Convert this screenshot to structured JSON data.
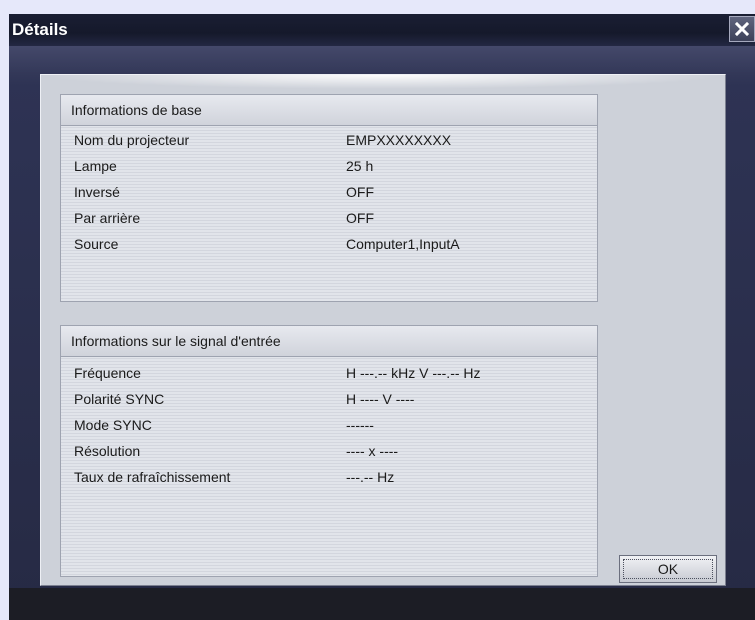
{
  "window": {
    "title": "Détails"
  },
  "icons": {
    "close": "close-icon"
  },
  "basic_info": {
    "header": "Informations de base",
    "rows": [
      {
        "label": "Nom du projecteur",
        "value": "EMPXXXXXXXX"
      },
      {
        "label": "Lampe",
        "value": "25 h"
      },
      {
        "label": "Inversé",
        "value": "OFF"
      },
      {
        "label": "Par arrière",
        "value": "OFF"
      },
      {
        "label": "Source",
        "value": "Computer1,InputA"
      }
    ]
  },
  "signal_info": {
    "header": "Informations sur le signal d'entrée",
    "rows": [
      {
        "label": "Fréquence",
        "value": "H ---.-- kHz  V ---.-- Hz"
      },
      {
        "label": "Polarité SYNC",
        "value": "H ----  V ----"
      },
      {
        "label": "Mode SYNC",
        "value": "------"
      },
      {
        "label": "Résolution",
        "value": "---- x ----"
      },
      {
        "label": "Taux de rafraîchissement",
        "value": "---.-- Hz"
      }
    ]
  },
  "buttons": {
    "ok": "OK"
  }
}
